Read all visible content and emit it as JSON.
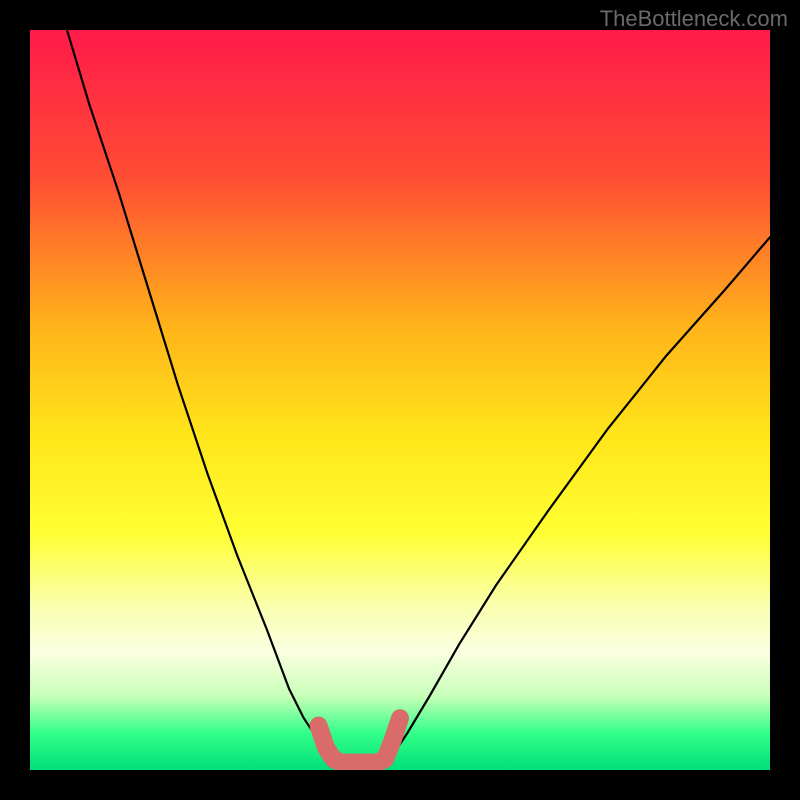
{
  "watermark": "TheBottleneck.com",
  "chart_data": {
    "type": "line",
    "title": "",
    "xlabel": "",
    "ylabel": "",
    "xlim": [
      0,
      100
    ],
    "ylim": [
      0,
      100
    ],
    "gradient_stops": [
      {
        "offset": 0,
        "color": "#ff1a4a"
      },
      {
        "offset": 20,
        "color": "#ff4d33"
      },
      {
        "offset": 40,
        "color": "#ffb31a"
      },
      {
        "offset": 55,
        "color": "#ffe61a"
      },
      {
        "offset": 68,
        "color": "#ffff33"
      },
      {
        "offset": 78,
        "color": "#f9ffb0"
      },
      {
        "offset": 84,
        "color": "#faffe0"
      },
      {
        "offset": 90,
        "color": "#c8ffb8"
      },
      {
        "offset": 95,
        "color": "#33ff88"
      },
      {
        "offset": 100,
        "color": "#00e07a"
      }
    ],
    "series": [
      {
        "name": "left-curve",
        "stroke": "#000000",
        "x": [
          5,
          8,
          12,
          16,
          20,
          24,
          28,
          32,
          35,
          37,
          39,
          40
        ],
        "y": [
          100,
          90,
          78,
          65,
          52,
          40,
          29,
          19,
          11,
          7,
          4,
          2
        ]
      },
      {
        "name": "right-curve",
        "stroke": "#000000",
        "x": [
          49,
          51,
          54,
          58,
          63,
          70,
          78,
          86,
          94,
          100
        ],
        "y": [
          2,
          5,
          10,
          17,
          25,
          35,
          46,
          56,
          65,
          72
        ]
      },
      {
        "name": "bottom-marker",
        "stroke": "#d96b6b",
        "stroke_width": 18,
        "x": [
          39,
          40,
          41,
          42,
          44,
          47,
          48,
          49,
          50
        ],
        "y": [
          6,
          3,
          1.5,
          1,
          1,
          1,
          1.5,
          4,
          7
        ]
      }
    ]
  }
}
